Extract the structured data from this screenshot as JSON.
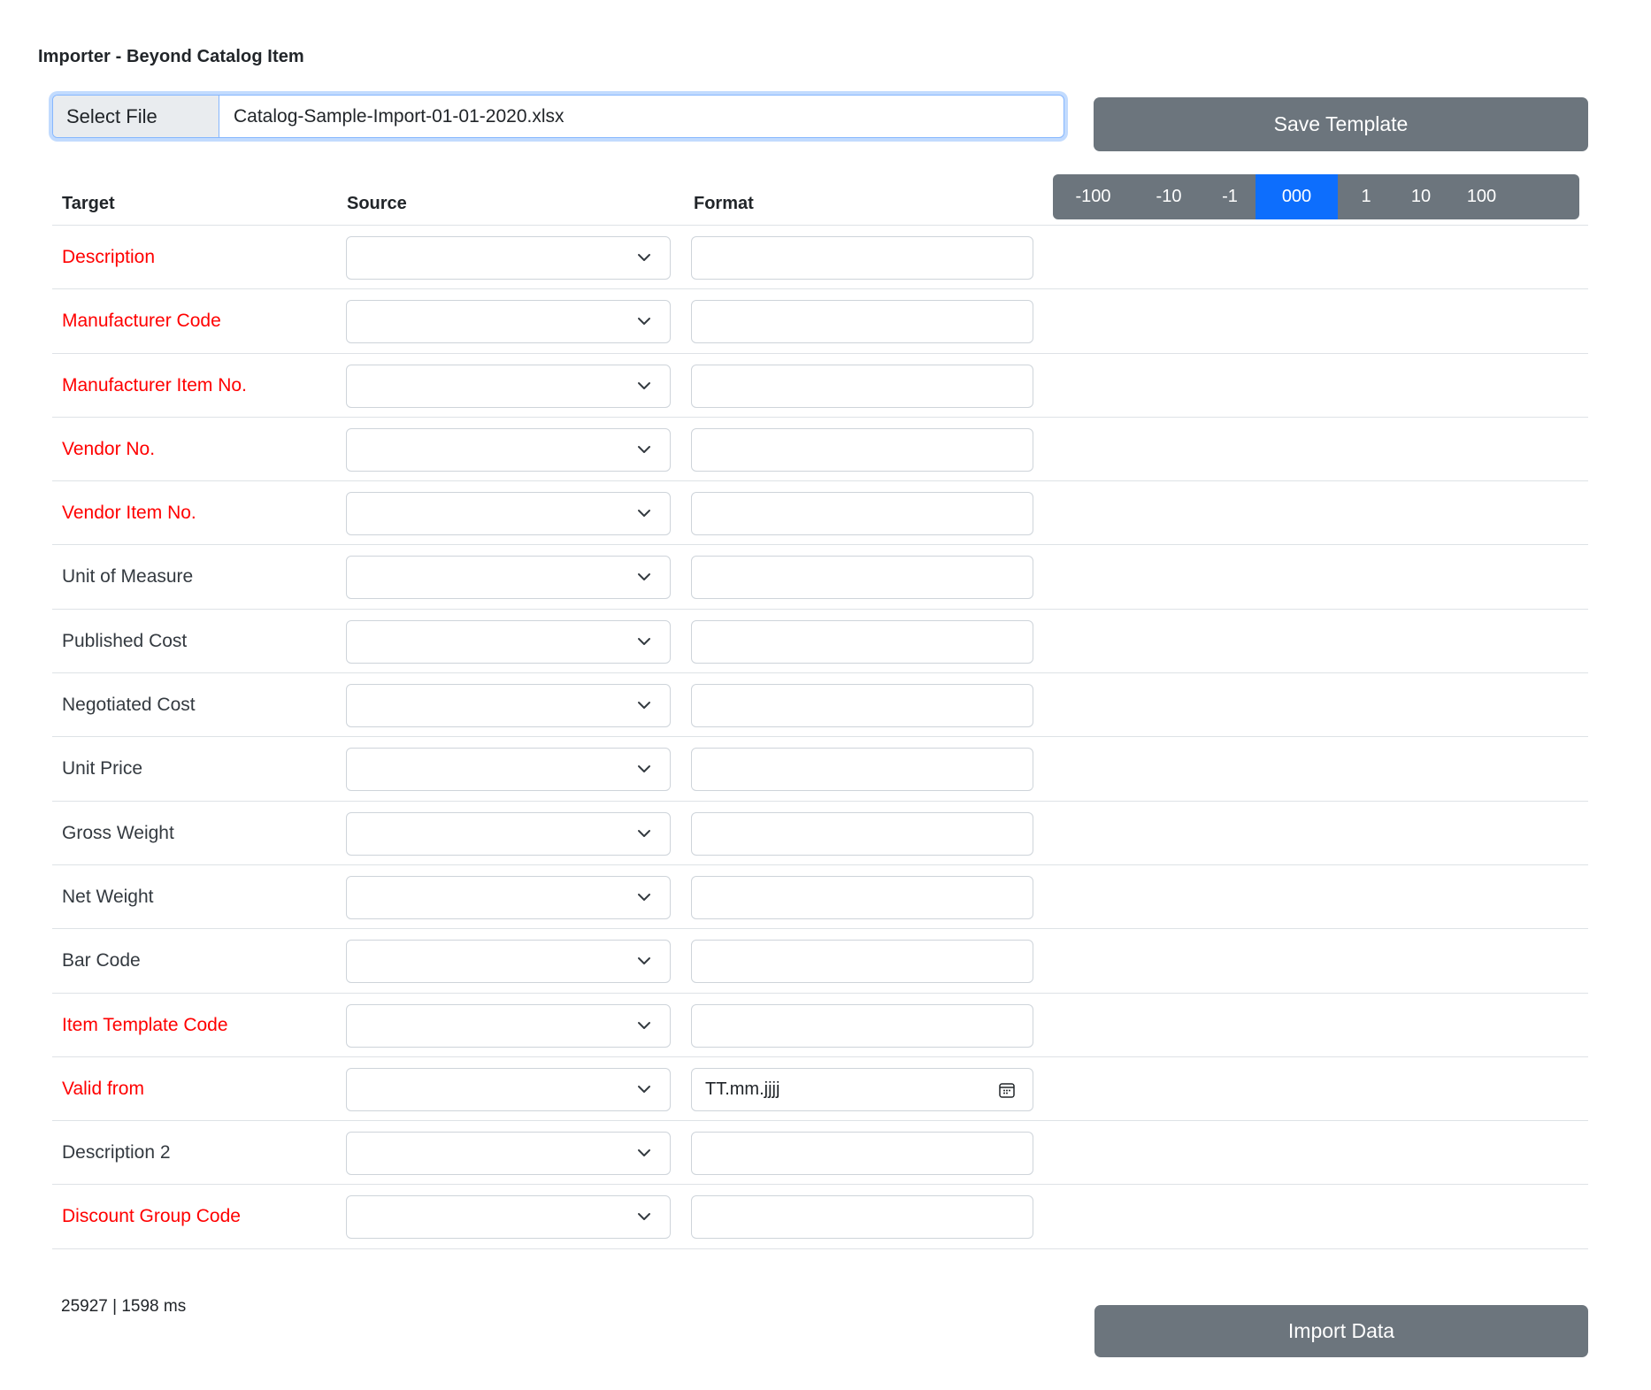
{
  "header": {
    "title": "Importer - Beyond Catalog Item"
  },
  "file": {
    "button_label": "Select File",
    "file_name": "Catalog-Sample-Import-01-01-2020.xlsx"
  },
  "toolbar": {
    "save_label": "Save Template",
    "import_label": "Import Data"
  },
  "table": {
    "headers": {
      "target": "Target",
      "source": "Source",
      "format": "Format"
    },
    "offset_steps": [
      {
        "label": "-100",
        "active": false
      },
      {
        "label": "-10",
        "active": false
      },
      {
        "label": "-1",
        "active": false
      },
      {
        "label": "000",
        "active": true
      },
      {
        "label": "1",
        "active": false
      },
      {
        "label": "10",
        "active": false
      },
      {
        "label": "100",
        "active": false
      }
    ],
    "rows": [
      {
        "target": "Description",
        "required": true,
        "source": "",
        "format": "",
        "format_type": "text"
      },
      {
        "target": "Manufacturer Code",
        "required": true,
        "source": "",
        "format": "",
        "format_type": "text"
      },
      {
        "target": "Manufacturer Item No.",
        "required": true,
        "source": "",
        "format": "",
        "format_type": "text"
      },
      {
        "target": "Vendor No.",
        "required": true,
        "source": "",
        "format": "",
        "format_type": "text"
      },
      {
        "target": "Vendor Item No.",
        "required": true,
        "source": "",
        "format": "",
        "format_type": "text"
      },
      {
        "target": "Unit of Measure",
        "required": false,
        "source": "",
        "format": "",
        "format_type": "text"
      },
      {
        "target": "Published Cost",
        "required": false,
        "source": "",
        "format": "",
        "format_type": "text"
      },
      {
        "target": "Negotiated Cost",
        "required": false,
        "source": "",
        "format": "",
        "format_type": "text"
      },
      {
        "target": "Unit Price",
        "required": false,
        "source": "",
        "format": "",
        "format_type": "text"
      },
      {
        "target": "Gross Weight",
        "required": false,
        "source": "",
        "format": "",
        "format_type": "text"
      },
      {
        "target": "Net Weight",
        "required": false,
        "source": "",
        "format": "",
        "format_type": "text"
      },
      {
        "target": "Bar Code",
        "required": false,
        "source": "",
        "format": "",
        "format_type": "text"
      },
      {
        "target": "Item Template Code",
        "required": true,
        "source": "",
        "format": "",
        "format_type": "text"
      },
      {
        "target": "Valid from",
        "required": true,
        "source": "",
        "format": "TT.mm.jjjj",
        "format_type": "date"
      },
      {
        "target": "Description 2",
        "required": false,
        "source": "",
        "format": "",
        "format_type": "text"
      },
      {
        "target": "Discount Group Code",
        "required": true,
        "source": "",
        "format": "",
        "format_type": "text"
      }
    ]
  },
  "footer": {
    "status": "25927 | 1598 ms"
  },
  "colors": {
    "required": "#ff0000",
    "button": "#6c757d",
    "active_step": "#0d6efd"
  },
  "icons": {
    "select_chevron": "chevron-down-icon",
    "date_picker": "calendar-icon"
  }
}
